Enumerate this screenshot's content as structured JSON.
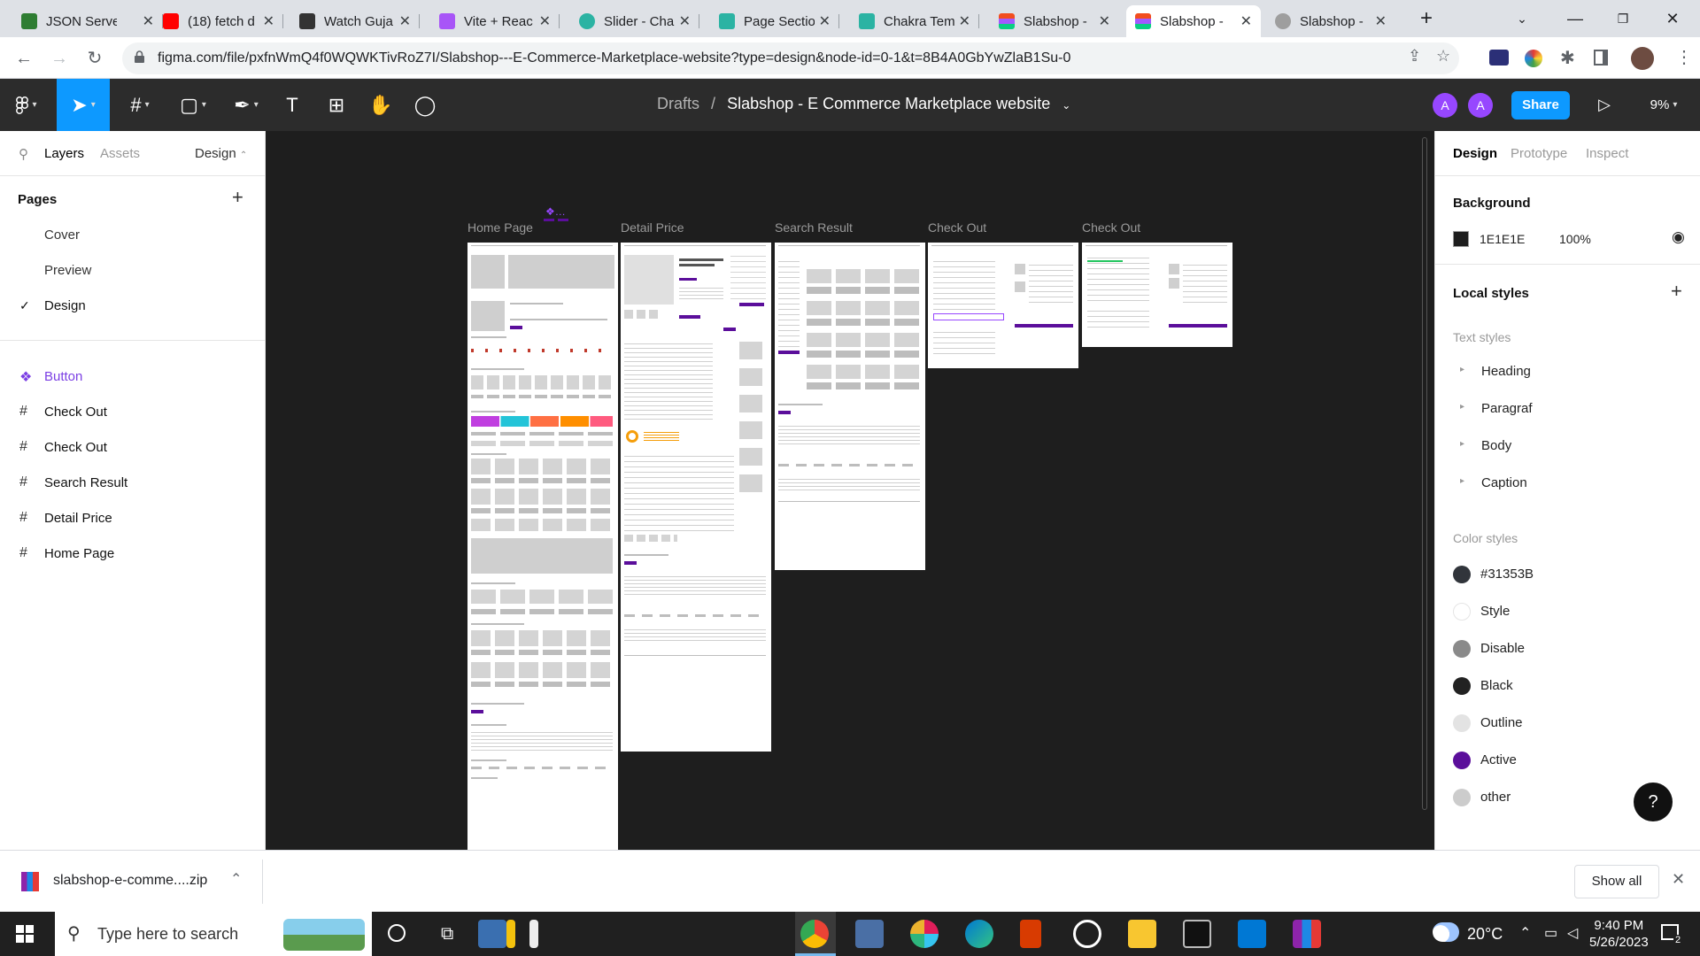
{
  "browser": {
    "tabs": [
      {
        "title": "JSON Serve",
        "favicon_color": "#2e7d32"
      },
      {
        "title": "(18) fetch d",
        "favicon_color": "#ff0000"
      },
      {
        "title": "Watch Guja",
        "favicon_color": "#333333"
      },
      {
        "title": "Vite + Reac",
        "favicon_color": "#a855f7"
      },
      {
        "title": "Slider - Cha",
        "favicon_color": "#2bb3a3"
      },
      {
        "title": "Page Sectio",
        "favicon_color": "#2bb3a3"
      },
      {
        "title": "Chakra Tem",
        "favicon_color": "#2bb3a3"
      },
      {
        "title": "Slabshop - ",
        "favicon_color": "#f24e1e"
      },
      {
        "title": "Slabshop - ",
        "favicon_color": "#f24e1e"
      },
      {
        "title": "Slabshop - ",
        "favicon_color": "#9e9e9e"
      }
    ],
    "url": "figma.com/file/pxfnWmQ4f0WQWKTivRoZ7I/Slabshop---E-Commerce-Marketplace-website?type=design&node-id=0-1&t=8B4A0GbYwZlaB1Su-0"
  },
  "figma": {
    "breadcrumb_parent": "Drafts",
    "breadcrumb_sep": "/",
    "file_title": "Slabshop - E Commerce Marketplace website",
    "avatars": [
      "A",
      "A"
    ],
    "share_label": "Share",
    "zoom": "9%"
  },
  "left_panel": {
    "tabs": [
      "Layers",
      "Assets"
    ],
    "mode": "Design",
    "pages_title": "Pages",
    "pages": [
      "Cover",
      "Preview",
      "Design"
    ],
    "active_page": "Design",
    "layers": [
      {
        "name": "Button",
        "type": "component"
      },
      {
        "name": "Check Out",
        "type": "frame"
      },
      {
        "name": "Check Out",
        "type": "frame"
      },
      {
        "name": "Search Result",
        "type": "frame"
      },
      {
        "name": "Detail Price",
        "type": "frame"
      },
      {
        "name": "Home Page",
        "type": "frame"
      }
    ]
  },
  "canvas": {
    "frames": [
      "Home Page",
      "Detail Price",
      "Search Result",
      "Check Out",
      "Check Out"
    ],
    "accent": "#5b0e9b"
  },
  "right_panel": {
    "tabs": [
      "Design",
      "Prototype",
      "Inspect"
    ],
    "background_title": "Background",
    "background_hex": "1E1E1E",
    "background_opacity": "100%",
    "local_styles_title": "Local styles",
    "text_styles_title": "Text styles",
    "text_styles": [
      "Heading",
      "Paragraf",
      "Body",
      "Caption"
    ],
    "color_styles_title": "Color styles",
    "color_styles": [
      {
        "name": "#31353B",
        "color": "#31353b"
      },
      {
        "name": "Style",
        "color": "#ffffff"
      },
      {
        "name": "Disable",
        "color": "#8a8a8a"
      },
      {
        "name": "Black",
        "color": "#222222"
      },
      {
        "name": "Outline",
        "color": "#e3e3e3"
      },
      {
        "name": "Active",
        "color": "#5b0e9b"
      },
      {
        "name": "other",
        "color": "#cccccc"
      }
    ],
    "help": "?"
  },
  "download": {
    "file": "slabshop-e-comme....zip",
    "show_all": "Show all"
  },
  "taskbar": {
    "search_placeholder": "Type here to search",
    "temperature": "20°C",
    "time": "9:40 PM",
    "date": "5/26/2023",
    "notifications": "2"
  }
}
